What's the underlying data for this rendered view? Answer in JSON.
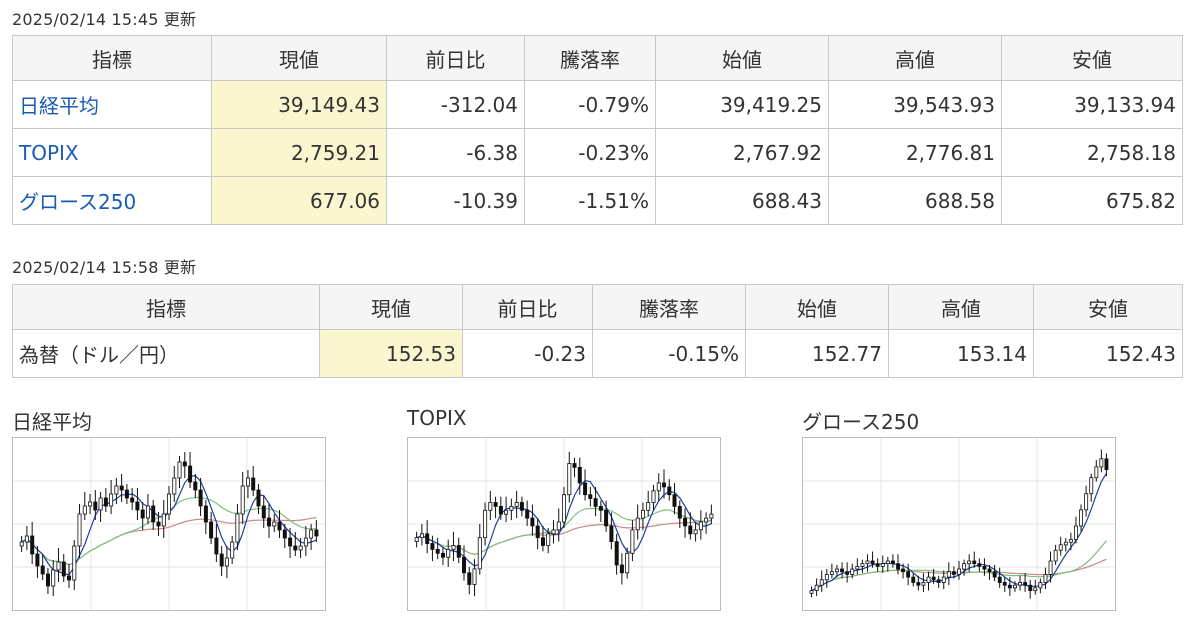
{
  "stock": {
    "updated": "2025/02/14 15:45 更新",
    "headers": [
      "指標",
      "現値",
      "前日比",
      "騰落率",
      "始値",
      "高値",
      "安値"
    ],
    "rows": [
      {
        "name": "日経平均",
        "current": "39,149.43",
        "change": "-312.04",
        "rate": "-0.79%",
        "open": "39,419.25",
        "high": "39,543.93",
        "low": "39,133.94"
      },
      {
        "name": "TOPIX",
        "current": "2,759.21",
        "change": "-6.38",
        "rate": "-0.23%",
        "open": "2,767.92",
        "high": "2,776.81",
        "low": "2,758.18"
      },
      {
        "name": "グロース250",
        "current": "677.06",
        "change": "-10.39",
        "rate": "-1.51%",
        "open": "688.43",
        "high": "688.58",
        "low": "675.82"
      }
    ]
  },
  "fx": {
    "updated": "2025/02/14 15:58 更新",
    "headers": [
      "指標",
      "現値",
      "前日比",
      "騰落率",
      "始値",
      "高値",
      "安値"
    ],
    "rows": [
      {
        "name": "為替（ドル／円）",
        "current": "152.53",
        "change": "-0.23",
        "rate": "-0.15%",
        "open": "152.77",
        "high": "153.14",
        "low": "152.43"
      }
    ]
  },
  "colors": {
    "link": "#1a5bb5",
    "highlight": "#fbf6cf",
    "ma_short": "#1f3f9e",
    "ma_mid": "#7fbf7f",
    "ma_long": "#c98a8a"
  },
  "chart_data": [
    {
      "type": "candlestick",
      "title": "日経平均",
      "grid": true,
      "legend": "none",
      "close": [
        52,
        55,
        46,
        40,
        36,
        30,
        38,
        42,
        35,
        33,
        50,
        66,
        70,
        72,
        68,
        74,
        70,
        76,
        80,
        78,
        74,
        72,
        68,
        64,
        70,
        62,
        60,
        66,
        76,
        84,
        92,
        90,
        82,
        78,
        70,
        62,
        54,
        46,
        40,
        44,
        52,
        66,
        80,
        84,
        78,
        70,
        64,
        60,
        62,
        58,
        54,
        50,
        48,
        50,
        54,
        58,
        55
      ]
    },
    {
      "type": "candlestick",
      "title": "TOPIX",
      "grid": true,
      "legend": "none",
      "close": [
        48,
        50,
        45,
        42,
        40,
        38,
        42,
        44,
        38,
        30,
        24,
        32,
        48,
        62,
        66,
        64,
        60,
        62,
        64,
        66,
        62,
        58,
        54,
        48,
        44,
        50,
        52,
        56,
        70,
        86,
        84,
        76,
        70,
        68,
        64,
        62,
        54,
        46,
        34,
        30,
        40,
        52,
        58,
        62,
        66,
        72,
        76,
        74,
        70,
        64,
        58,
        54,
        50,
        52,
        56,
        58,
        60
      ]
    },
    {
      "type": "candlestick",
      "title": "グロース250",
      "grid": true,
      "legend": "none",
      "close": [
        24,
        28,
        32,
        36,
        38,
        40,
        38,
        36,
        40,
        42,
        44,
        46,
        44,
        42,
        44,
        46,
        44,
        40,
        38,
        34,
        30,
        28,
        30,
        34,
        32,
        30,
        34,
        38,
        36,
        40,
        44,
        46,
        44,
        42,
        40,
        38,
        34,
        30,
        28,
        26,
        28,
        30,
        28,
        24,
        26,
        30,
        36,
        46,
        54,
        58,
        60,
        62,
        72,
        84,
        96,
        108,
        116,
        122,
        114
      ]
    }
  ]
}
